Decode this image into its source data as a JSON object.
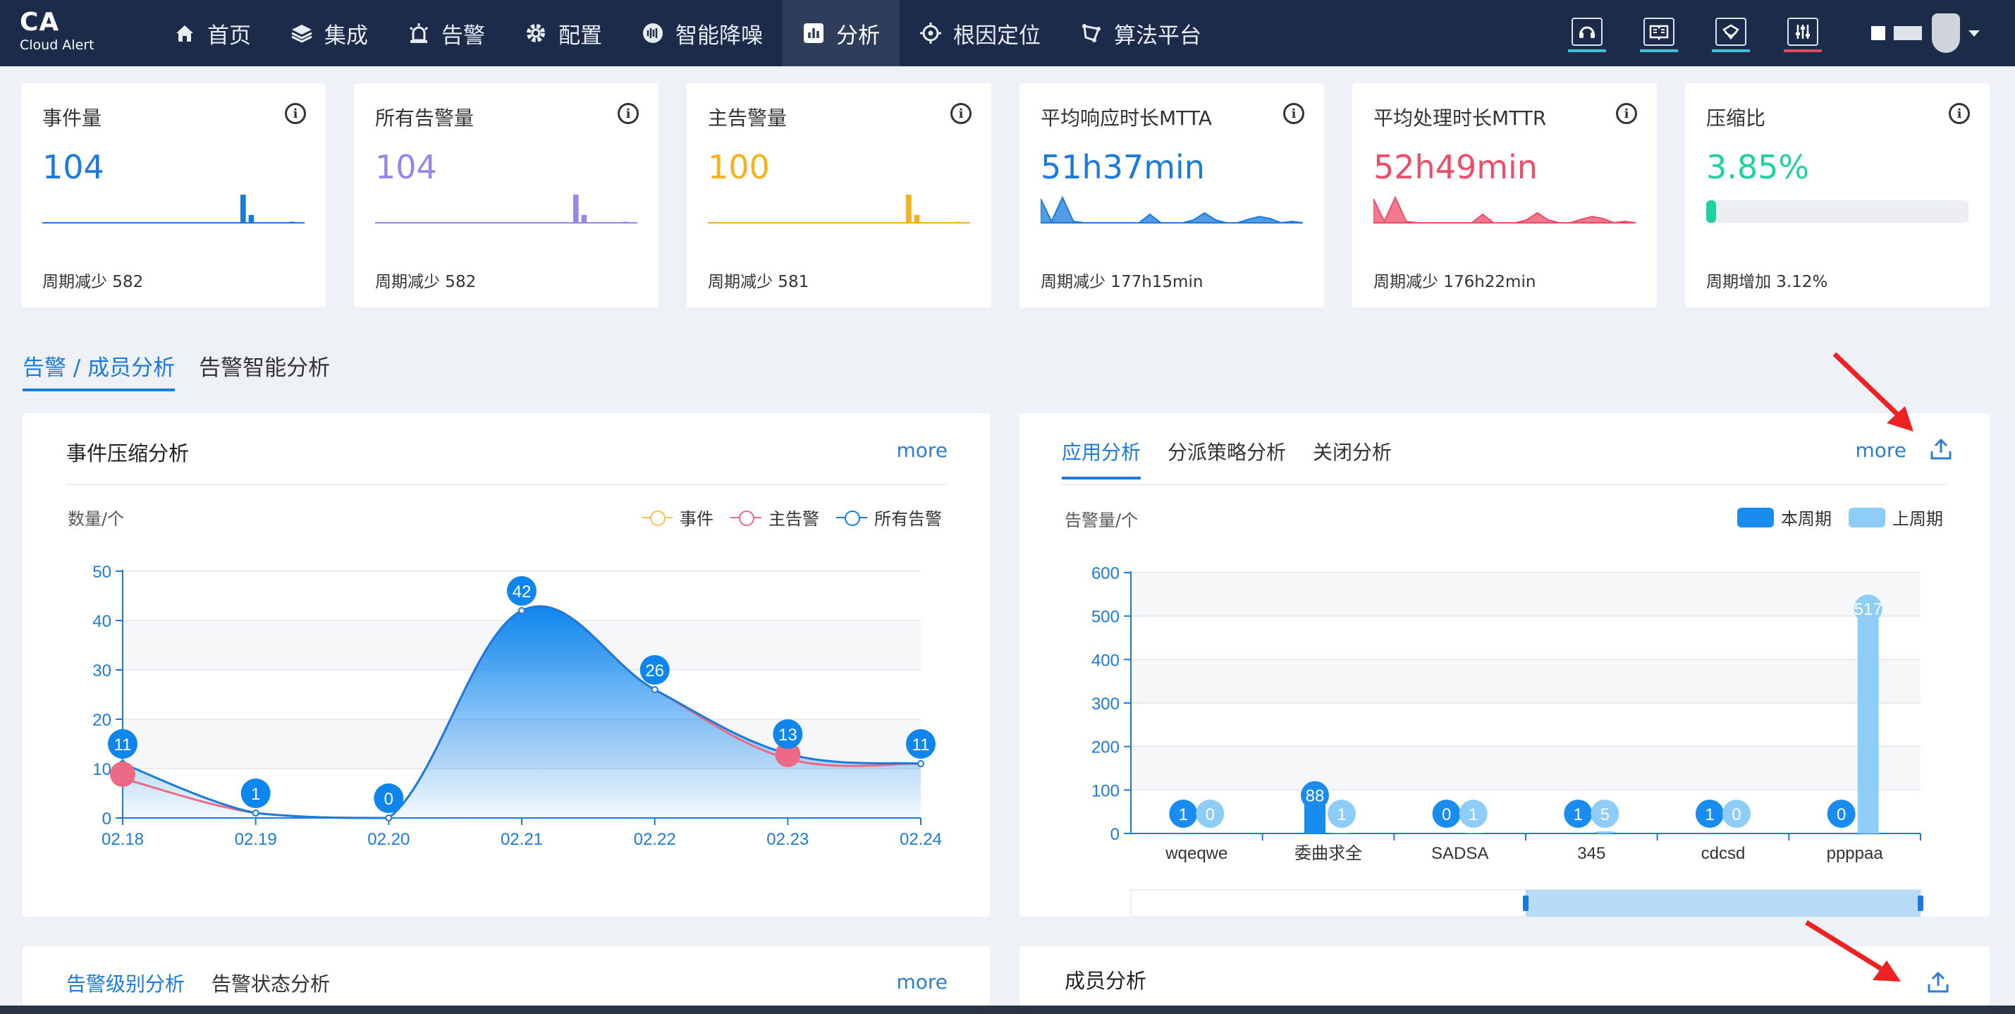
{
  "brand": {
    "name": "CA",
    "subtitle": "Cloud Alert"
  },
  "nav": [
    {
      "label": "首页",
      "icon": "home-icon"
    },
    {
      "label": "集成",
      "icon": "layers-icon"
    },
    {
      "label": "告警",
      "icon": "alarm-icon"
    },
    {
      "label": "配置",
      "icon": "gear-icon"
    },
    {
      "label": "智能降噪",
      "icon": "noise-reduction-icon"
    },
    {
      "label": "分析",
      "icon": "bar-chart-icon",
      "active": true
    },
    {
      "label": "根因定位",
      "icon": "target-icon"
    },
    {
      "label": "算法平台",
      "icon": "algorithm-icon"
    }
  ],
  "kpis": [
    {
      "title": "事件量",
      "value": "104",
      "color": "#1a7bdc",
      "sub": "周期减少 582",
      "spark_color": "#1a7bdc"
    },
    {
      "title": "所有告警量",
      "value": "104",
      "color": "#9a86e8",
      "sub": "周期减少 582",
      "spark_color": "#9a86e8"
    },
    {
      "title": "主告警量",
      "value": "100",
      "color": "#f5b21d",
      "sub": "周期减少 581",
      "spark_color": "#f5b21d"
    },
    {
      "title": "平均响应时长MTTA",
      "value": "51h37min",
      "color": "#1a7bdc",
      "sub": "周期减少 177h15min",
      "spark_color": "#1a7bdc"
    },
    {
      "title": "平均处理时长MTTR",
      "value": "52h49min",
      "color": "#ec4d68",
      "sub": "周期减少 176h22min",
      "spark_color": "#ec4d68"
    },
    {
      "title": "压缩比",
      "value": "3.85%",
      "color": "#1fd1a1",
      "sub": "周期增加 3.12%",
      "progress": 0.0385
    }
  ],
  "main_tabs": [
    {
      "label": "告警 / 成员分析",
      "active": true
    },
    {
      "label": "告警智能分析"
    }
  ],
  "compression_panel": {
    "title": "事件压缩分析",
    "more": "more",
    "legend": [
      {
        "name": "事件",
        "color": "#f5c153"
      },
      {
        "name": "主告警",
        "color": "#ec6a84"
      },
      {
        "name": "所有告警",
        "color": "#1a7bdc"
      }
    ]
  },
  "app_panel": {
    "tabs": [
      "应用分析",
      "分派策略分析",
      "关闭分析"
    ],
    "more": "more",
    "legend": [
      {
        "name": "本周期",
        "color": "#1a8cf0"
      },
      {
        "name": "上周期",
        "color": "#8ecdf7"
      }
    ]
  },
  "level_panel": {
    "tabs": [
      "告警级别分析",
      "告警状态分析"
    ],
    "more": "more"
  },
  "member_panel": {
    "title": "成员分析"
  },
  "chart_data": [
    {
      "type": "area",
      "ylabel": "数量/个",
      "ylim": [
        0,
        50
      ],
      "yticks": [
        0,
        10,
        20,
        30,
        40,
        50
      ],
      "categories": [
        "02.18",
        "02.19",
        "02.20",
        "02.21",
        "02.22",
        "02.23",
        "02.24"
      ],
      "series": [
        {
          "name": "所有告警",
          "values": [
            11,
            1,
            0,
            42,
            26,
            13,
            11
          ]
        },
        {
          "name": "主告警",
          "values": [
            8,
            1,
            0,
            42,
            26,
            12,
            11
          ]
        }
      ],
      "labels": [
        11,
        1,
        0,
        42,
        26,
        13,
        11
      ]
    },
    {
      "type": "bar",
      "ylabel": "告警量/个",
      "ylim": [
        0,
        600
      ],
      "yticks": [
        0,
        100,
        200,
        300,
        400,
        500,
        600
      ],
      "categories": [
        "wqeqwe",
        "委曲求全",
        "SADSA",
        "345",
        "cdcsd",
        "ppppaa"
      ],
      "series": [
        {
          "name": "本周期",
          "values": [
            1,
            88,
            0,
            1,
            1,
            0
          ]
        },
        {
          "name": "上周期",
          "values": [
            0,
            1,
            1,
            5,
            0,
            517
          ]
        }
      ]
    }
  ]
}
